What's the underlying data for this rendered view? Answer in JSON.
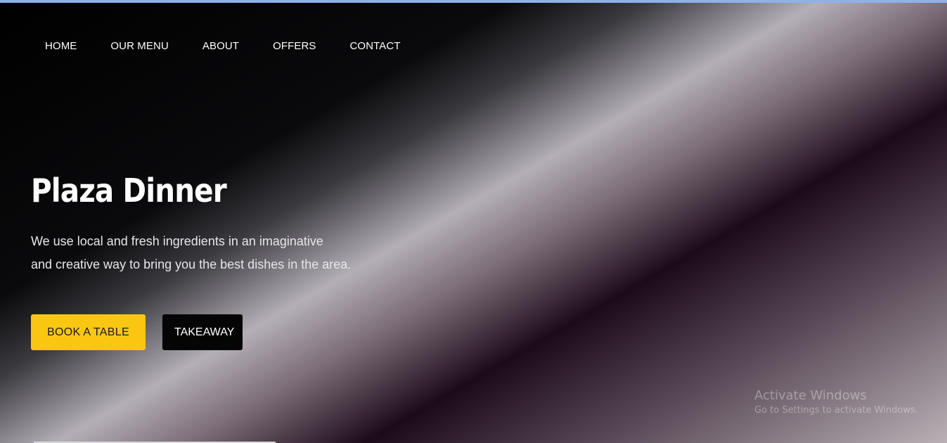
{
  "nav": {
    "items": [
      "HOME",
      "OUR MENU",
      "ABOUT",
      "OFFERS",
      "CONTACT"
    ]
  },
  "hero": {
    "title": "Plaza Dinner",
    "text_line1": "We use local and fresh ingredients in an imaginative",
    "text_line2": "and creative way to bring you the best dishes in the area.",
    "book_label": "BOOK A TABLE",
    "takeaway_label": "TAKEAWAY"
  },
  "watermark": {
    "title": "Activate Windows",
    "subtitle": "Go to Settings to activate Windows."
  },
  "colors": {
    "accent": "#f9c712",
    "dark_button": "#050505",
    "text": "#ffffff",
    "top_strip": "#8fb1e8"
  }
}
